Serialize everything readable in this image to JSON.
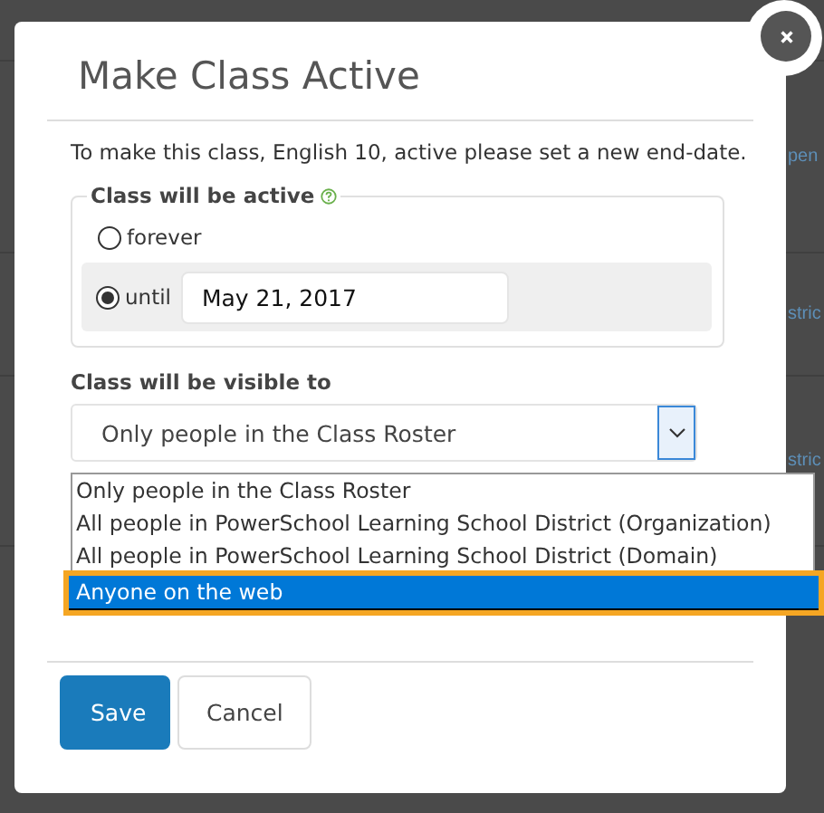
{
  "background_table": {
    "rows": [
      {
        "cells": [
          "pen"
        ]
      },
      {
        "cells": [
          "stric"
        ]
      },
      {
        "cells": [
          "stric"
        ]
      }
    ]
  },
  "dialog": {
    "title": "Make Class Active",
    "intro": "To make this class, English 10, active please set a new end-date.",
    "active_group": {
      "legend": "Class will be active",
      "options": [
        {
          "kind": "plain",
          "label": "forever",
          "selected": false
        },
        {
          "kind": "date",
          "label": "until",
          "selected": true,
          "value": "May 21, 2017"
        }
      ]
    },
    "visibility": {
      "label": "Class will be visible to",
      "value": "Only people in the Class Roster",
      "expanded": true,
      "options": [
        {
          "label": "Only people in the Class Roster",
          "highlighted": false
        },
        {
          "label": "All people in PowerSchool Learning School District (Organization)",
          "highlighted": false
        },
        {
          "label": "All people in PowerSchool Learning School District (Domain)",
          "highlighted": false
        },
        {
          "label": "Anyone on the web",
          "highlighted": true
        }
      ]
    },
    "buttons": [
      {
        "label": "Save",
        "kind": "primary"
      },
      {
        "label": "Cancel",
        "kind": "secondary"
      }
    ]
  }
}
